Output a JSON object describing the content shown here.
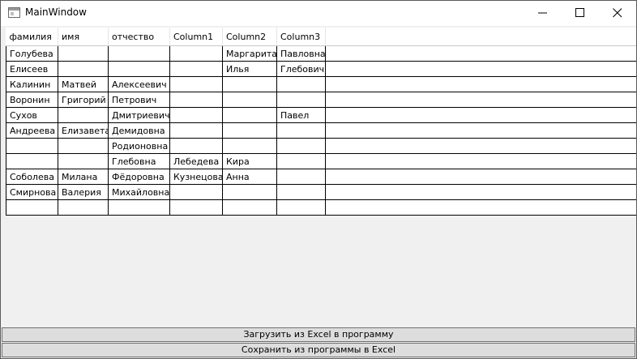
{
  "window": {
    "title": "MainWindow"
  },
  "grid": {
    "columns": [
      "фамилия",
      "имя",
      "отчество",
      "Column1",
      "Column2",
      "Column3"
    ],
    "rows": [
      [
        "Голубева",
        "",
        "",
        "",
        "Маргарита",
        "Павловна"
      ],
      [
        "Елисеев",
        "",
        "",
        "",
        "Илья",
        "Глебович"
      ],
      [
        "Калинин",
        "Матвей",
        "Алексеевич",
        "",
        "",
        ""
      ],
      [
        "Воронин",
        "Григорий",
        "Петрович",
        "",
        "",
        ""
      ],
      [
        "Сухов",
        "",
        "Дмитриевич",
        "",
        "",
        "Павел"
      ],
      [
        "Андреева",
        "Елизавета",
        "Демидовна",
        "",
        "",
        ""
      ],
      [
        "",
        "",
        "Родионовна",
        "",
        "",
        ""
      ],
      [
        "",
        "",
        "Глебовна",
        "Лебедева",
        "Кира",
        ""
      ],
      [
        "Соболева",
        "Милана",
        "Фёдоровна",
        "Кузнецова",
        "Анна",
        ""
      ],
      [
        "Смирнова",
        "Валерия",
        "Михайловна",
        "",
        "",
        ""
      ],
      [
        "",
        "",
        "",
        "",
        "",
        ""
      ]
    ]
  },
  "buttons": {
    "load": "Загрузить из Excel в программу",
    "save": "Сохранить из программы в Excel"
  },
  "icons": {
    "app": "window-app-icon",
    "minimize": "minimize-icon",
    "maximize": "maximize-icon",
    "close": "close-icon"
  }
}
